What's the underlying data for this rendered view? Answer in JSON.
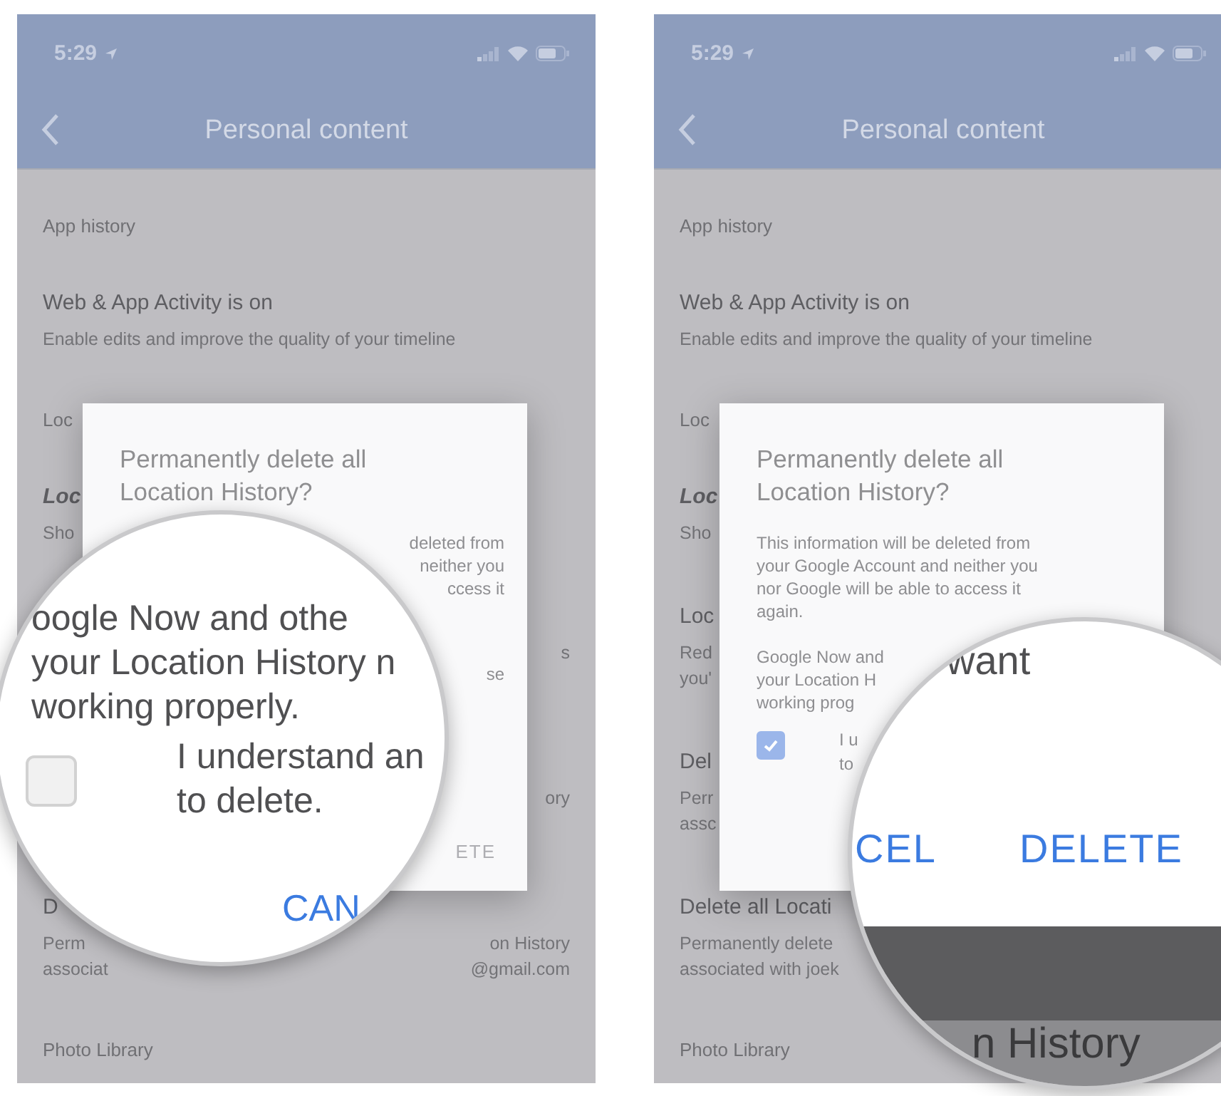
{
  "panels": [
    {
      "status_bar": {
        "time": "5:29"
      },
      "header": {
        "title": "Personal content"
      },
      "rows": [
        {
          "kind": "section",
          "left": "App history"
        },
        {
          "kind": "title",
          "left": "Web & App Activity is on"
        },
        {
          "kind": "sub",
          "left": "Enable edits and improve the quality of your timeline"
        },
        {
          "kind": "section",
          "left": "Loc"
        },
        {
          "kind": "title",
          "left": "Loc",
          "emphasis": true
        },
        {
          "kind": "sub",
          "left": "Sho"
        },
        {
          "kind": "title"
        },
        {
          "kind": "sub",
          "right": "s"
        },
        {
          "kind": "sub"
        },
        {
          "kind": "title"
        },
        {
          "kind": "sub",
          "right": "ory"
        },
        {
          "kind": "sub"
        },
        {
          "kind": "title",
          "left": "D"
        },
        {
          "kind": "sub",
          "left": "Perm",
          "right": "on History"
        },
        {
          "kind": "sub",
          "left": "associat",
          "right": "@gmail.com"
        },
        {
          "kind": "section",
          "left": "Photo Library"
        }
      ],
      "dialog": {
        "kind": "covered",
        "title": "Permanently delete all Location History?",
        "paragraphs": [
          [
            "deleted from",
            "neither you",
            "ccess it"
          ],
          [
            "se"
          ]
        ],
        "buttons": [
          {
            "label": "ETE",
            "disabled": true
          }
        ]
      },
      "magnifier": {
        "kind": "checkbox",
        "lines": [
          "oogle Now and othe",
          "your Location History n",
          "working properly."
        ],
        "checkbox": {
          "checked": false,
          "label_lines": [
            "I understand an",
            "to delete."
          ]
        },
        "button": "CAN"
      }
    },
    {
      "status_bar": {
        "time": "5:29"
      },
      "header": {
        "title": "Personal content"
      },
      "rows": [
        {
          "kind": "section",
          "left": "App history"
        },
        {
          "kind": "title",
          "left": "Web & App Activity is on"
        },
        {
          "kind": "sub",
          "left": "Enable edits and improve the quality of your timeline"
        },
        {
          "kind": "section",
          "left": "Loc"
        },
        {
          "kind": "title",
          "left": "Loc",
          "emphasis": true
        },
        {
          "kind": "sub",
          "left": "Sho"
        },
        {
          "kind": "title",
          "left": "Loc"
        },
        {
          "kind": "sub",
          "left": "Red"
        },
        {
          "kind": "sub",
          "left": "you'"
        },
        {
          "kind": "title",
          "left": "Del"
        },
        {
          "kind": "sub",
          "left": "Perr"
        },
        {
          "kind": "sub",
          "left": "assc"
        },
        {
          "kind": "title",
          "left": "Delete all Locati"
        },
        {
          "kind": "sub",
          "left": "Permanently delete"
        },
        {
          "kind": "sub",
          "left": "associated with joek"
        },
        {
          "kind": "section",
          "left": "Photo Library"
        }
      ],
      "dialog": {
        "kind": "full",
        "title": "Permanently delete all Location History?",
        "paragraphs": [
          [
            "This information will be deleted from",
            "your Google Account and neither you",
            "nor Google will be able to access it",
            "again."
          ],
          [
            "Google Now and",
            "your Location H",
            "working prog"
          ]
        ],
        "checkbox": {
          "checked": true,
          "label_lines": [
            "I u",
            "to"
          ]
        }
      },
      "magnifier": {
        "kind": "buttons",
        "lines": [
          "want"
        ],
        "buttons": [
          "CEL",
          "DELETE"
        ],
        "below": "n History"
      }
    }
  ]
}
